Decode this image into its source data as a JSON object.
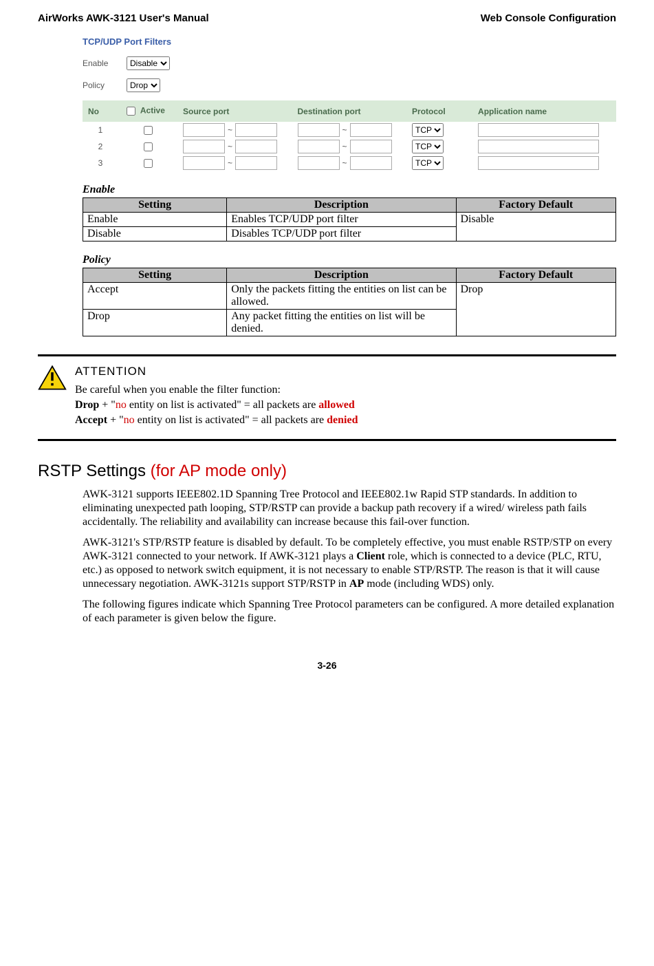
{
  "header": {
    "left": "AirWorks AWK-3121 User's Manual",
    "right": "Web Console Configuration"
  },
  "filter_panel": {
    "title": "TCP/UDP Port Filters",
    "enable_label": "Enable",
    "enable_value": "Disable",
    "policy_label": "Policy",
    "policy_value": "Drop",
    "columns": {
      "no": "No",
      "active": "Active",
      "source_port": "Source port",
      "dest_port": "Destination port",
      "protocol": "Protocol",
      "app_name": "Application name"
    },
    "rows": [
      {
        "no": "1",
        "proto": "TCP"
      },
      {
        "no": "2",
        "proto": "TCP"
      },
      {
        "no": "3",
        "proto": "TCP"
      }
    ],
    "tilde": "~"
  },
  "enable_table": {
    "caption": "Enable",
    "headers": {
      "setting": "Setting",
      "description": "Description",
      "default": "Factory Default"
    },
    "rows": [
      {
        "setting": "Enable",
        "description": "Enables TCP/UDP port filter"
      },
      {
        "setting": "Disable",
        "description": "Disables TCP/UDP port filter"
      }
    ],
    "default": "Disable"
  },
  "policy_table": {
    "caption": "Policy",
    "headers": {
      "setting": "Setting",
      "description": "Description",
      "default": "Factory Default"
    },
    "rows": [
      {
        "setting": "Accept",
        "description": "Only the packets fitting the entities on list can be allowed."
      },
      {
        "setting": "Drop",
        "description": "Any packet fitting the entities on list will be denied."
      }
    ],
    "default": "Drop"
  },
  "attention": {
    "title": "ATTENTION",
    "line1": "Be careful when you enable the filter function:",
    "drop_bold": "Drop",
    "plus": " + \"",
    "no_red": "no",
    "drop_rest": " entity on list is activated\" = all packets are ",
    "allowed": "allowed",
    "accept_bold": "Accept",
    "accept_rest": " entity on list is activated\" = all packets are ",
    "denied": "denied"
  },
  "section": {
    "title_black": "RSTP Settings ",
    "title_red": "(for AP mode only)",
    "p1": "AWK-3121 supports IEEE802.1D Spanning Tree Protocol and IEEE802.1w Rapid STP standards. In addition to eliminating unexpected path looping, STP/RSTP can provide a backup path recovery if a wired/ wireless path fails accidentally. The reliability and availability can increase because this fail-over function.",
    "p2_a": "AWK-3121's STP/RSTP feature is disabled by default. To be completely effective, you must enable RSTP/STP on every AWK-3121 connected to your network. If AWK-3121 plays a ",
    "p2_client": "Client",
    "p2_b": " role, which is connected to a device (PLC, RTU, etc.) as opposed to network switch equipment, it is not necessary to enable STP/RSTP. The reason is that it will cause unnecessary negotiation. AWK-3121s support STP/RSTP in ",
    "p2_ap": "AP",
    "p2_c": " mode (including WDS) only.",
    "p3": "The following figures indicate which Spanning Tree Protocol parameters can be configured. A more detailed explanation of each parameter is given below the figure."
  },
  "footer": "3-26"
}
